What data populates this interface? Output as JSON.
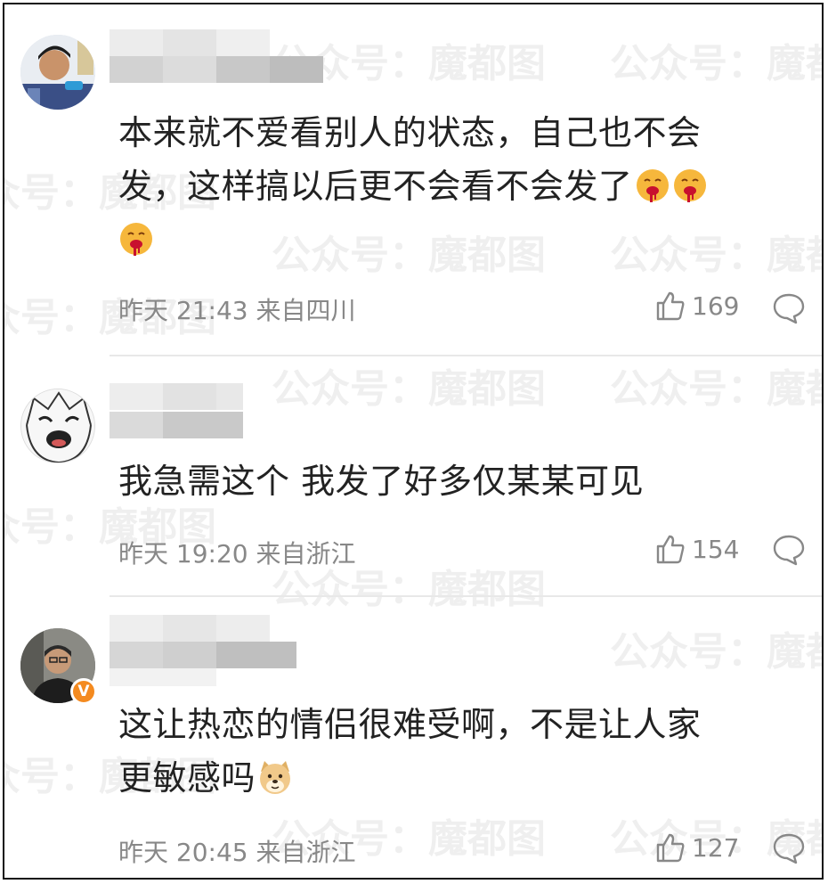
{
  "comments": [
    {
      "text_line1": "本来就不爱看别人的状态，自己也不会",
      "text_line2": "发，这样搞以后更不会看不会发了",
      "time": "昨天 21:43",
      "location": "来自四川",
      "likes": "169",
      "emojis": [
        "vomit-blood-emoji",
        "vomit-blood-emoji",
        "vomit-blood-emoji"
      ]
    },
    {
      "text_line1": "我急需这个 我发了好多仅某某可见",
      "time": "昨天 19:20",
      "location": "来自浙江",
      "likes": "154"
    },
    {
      "text_line1": "这让热恋的情侣很难受啊，不是让人家",
      "text_line2": "更敏感吗",
      "time": "昨天 20:45",
      "location": "来自浙江",
      "likes": "127",
      "verified_badge": "V",
      "emojis": [
        "doge-emoji"
      ]
    }
  ],
  "watermark": "公众号：魔都图",
  "colors": {
    "meta": "#888888",
    "badge": "#f48a1f",
    "emoji": "#f6b73c"
  }
}
